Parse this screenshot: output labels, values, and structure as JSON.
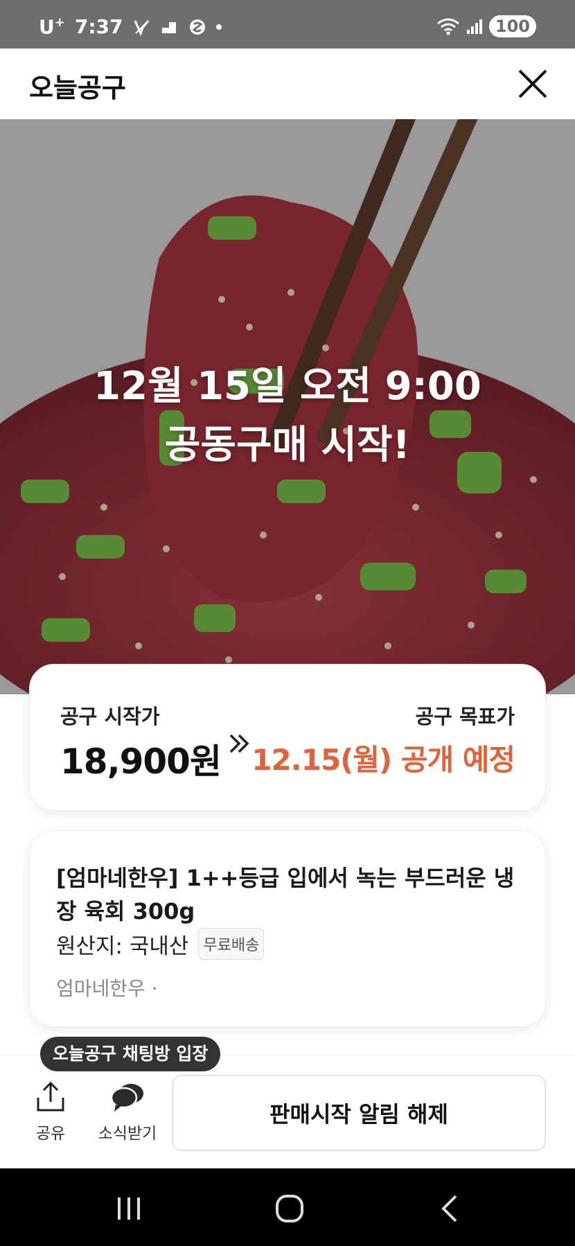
{
  "status_bar": {
    "carrier": "U",
    "carrier_sup": "+",
    "time": "7:37",
    "battery": "100"
  },
  "header": {
    "title": "오늘공구",
    "close_icon": "close-icon"
  },
  "hero": {
    "line1": "12월 15일 오전 9:00",
    "line2": "공동구매 시작!"
  },
  "price_card": {
    "start_label": "공구 시작가",
    "start_price": "18,900원",
    "target_label": "공구 목표가",
    "target_value": "12.15(월) 공개 예정",
    "accent_color": "#e0643a"
  },
  "product": {
    "name": "[엄마네한우] 1++등급 입에서 녹는 부드러운 냉장 육회 300g",
    "origin": "원산지: 국내산",
    "badge": "무료배송",
    "seller": "엄마네한우 ·"
  },
  "bottom_bar": {
    "tooltip": "오늘공구 채팅방 입장",
    "share_label": "공유",
    "news_label": "소식받기",
    "unsubscribe_label": "판매시작 알림 해제"
  }
}
